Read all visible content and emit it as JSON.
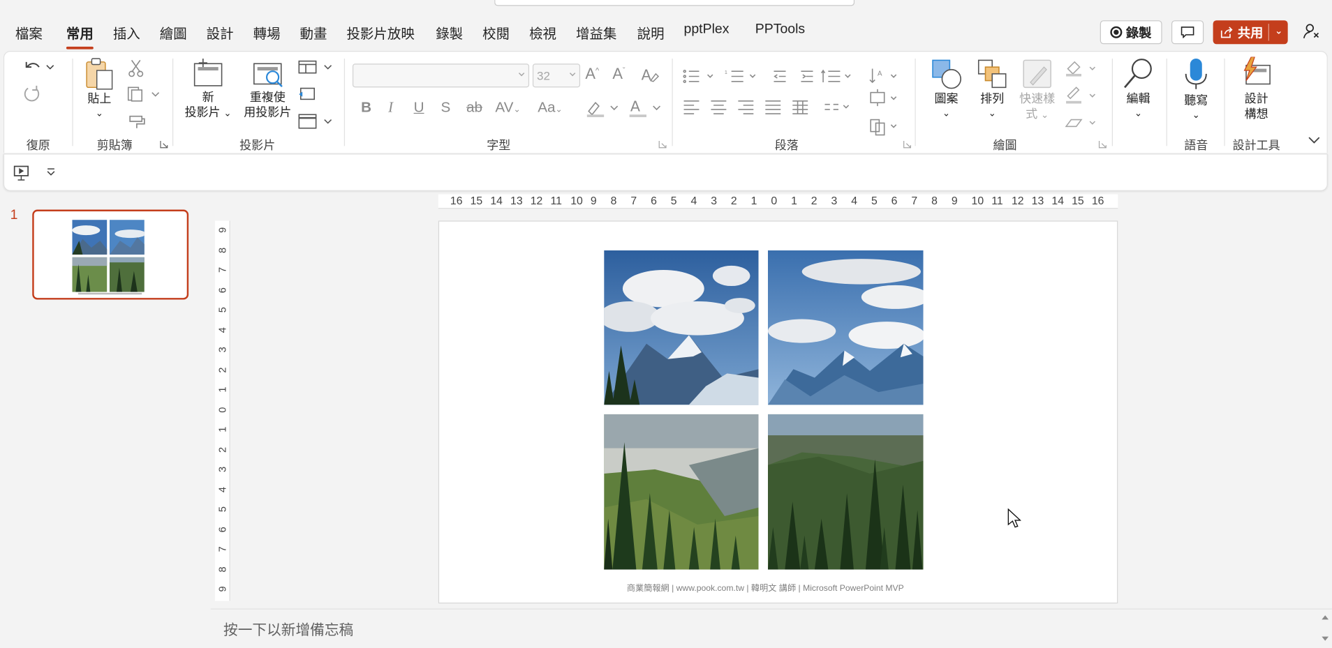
{
  "menu": {
    "tabs": [
      "檔案",
      "常用",
      "插入",
      "繪圖",
      "設計",
      "轉場",
      "動畫",
      "投影片放映",
      "錄製",
      "校閱",
      "檢視",
      "增益集",
      "說明",
      "pptPlex",
      "PPTools"
    ],
    "active_tab": "常用",
    "record_label": "錄製",
    "share_label": "共用"
  },
  "ribbon": {
    "groups": {
      "undo": "復原",
      "clipboard": "剪貼簿",
      "slides": "投影片",
      "font": "字型",
      "paragraph": "段落",
      "drawing": "繪圖",
      "voice": "語音",
      "designer": "設計工具"
    },
    "paste_label": "貼上",
    "new_slide_label_1": "新",
    "new_slide_label_2": "投影片",
    "reuse_slides_label_1": "重複使",
    "reuse_slides_label_2": "用投影片",
    "font_size_value": "32",
    "font_name_value": "",
    "shapes_label": "圖案",
    "arrange_label": "排列",
    "quick_styles_label_1": "快速樣",
    "quick_styles_label_2": "式",
    "editing_label": "編輯",
    "dictate_label": "聽寫",
    "designer_label_1": "設計",
    "designer_label_2": "構想"
  },
  "slides_pane": {
    "slide_number": "1"
  },
  "ruler": {
    "horizontal": [
      "16",
      "15",
      "14",
      "13",
      "12",
      "11",
      "10",
      "9",
      "8",
      "7",
      "6",
      "5",
      "4",
      "3",
      "2",
      "1",
      "0",
      "1",
      "2",
      "3",
      "4",
      "5",
      "6",
      "7",
      "8",
      "9",
      "10",
      "11",
      "12",
      "13",
      "14",
      "15",
      "16"
    ],
    "vertical": [
      "9",
      "8",
      "7",
      "6",
      "5",
      "4",
      "3",
      "2",
      "1",
      "0",
      "1",
      "2",
      "3",
      "4",
      "5",
      "6",
      "7",
      "8",
      "9"
    ]
  },
  "slide": {
    "caption": "商業簡報網 | www.pook.com.tw | 韓明文 講師 | Microsoft PowerPoint MVP",
    "photos": [
      "sky-with-clouds-over-mountain-peak",
      "blue-sky-over-snowy-mountains",
      "valley-with-pine-trees",
      "forest-hillside-with-pines"
    ]
  },
  "notes": {
    "placeholder": "按一下以新增備忘稿"
  },
  "colors": {
    "accent": "#c43e1c",
    "ribbon_bg": "#ffffff",
    "app_bg": "#f3f3f3",
    "icon_blue": "#2b88d8",
    "icon_orange": "#e8a33d"
  }
}
